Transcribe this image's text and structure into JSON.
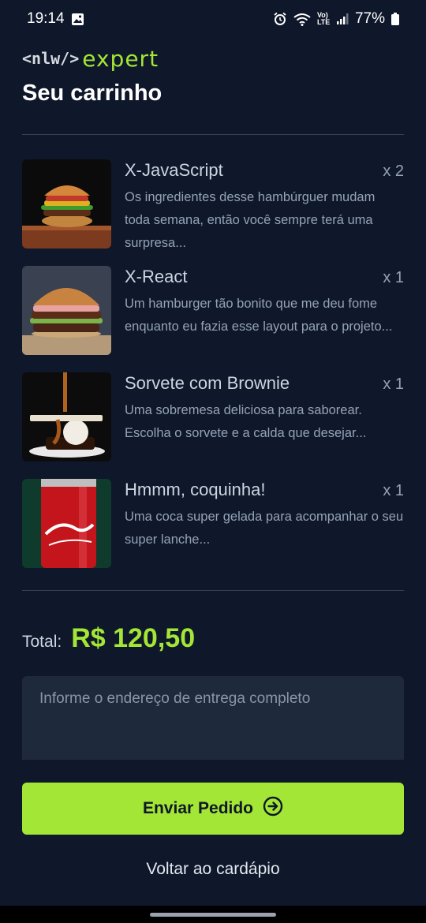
{
  "status_bar": {
    "time": "19:14",
    "battery": "77%",
    "network_label": "Vo) LTE"
  },
  "header": {
    "logo_prefix": "<nlw/>",
    "logo_word": "expert",
    "title": "Seu carrinho"
  },
  "cart": {
    "items": [
      {
        "name": "X-JavaScript",
        "qty": "x 2",
        "description": "Os ingredientes desse hambúrguer mudam toda semana, então você sempre terá uma surpresa..."
      },
      {
        "name": "X-React",
        "qty": "x 1",
        "description": "Um hamburger tão bonito que me deu fome enquanto eu fazia esse layout para o projeto..."
      },
      {
        "name": "Sorvete com Brownie",
        "qty": "x 1",
        "description": "Uma sobremesa deliciosa para saborear. Escolha o sorvete e a calda que desejar..."
      },
      {
        "name": "Hmmm, coquinha!",
        "qty": "x 1",
        "description": "Uma coca super gelada para acompanhar o seu super lanche..."
      }
    ]
  },
  "total": {
    "label": "Total:",
    "value": "R$ 120,50"
  },
  "address": {
    "placeholder": "Informe o endereço de entrega completo",
    "value": ""
  },
  "actions": {
    "send_label": "Enviar Pedido",
    "back_label": "Voltar ao cardápio"
  },
  "colors": {
    "background": "#0f172a",
    "accent": "#a3e635",
    "input_bg": "#1e293b"
  },
  "icons": [
    "gallery-icon",
    "alarm-icon",
    "wifi-icon",
    "signal-icon",
    "battery-icon",
    "arrow-circle-right-icon"
  ]
}
